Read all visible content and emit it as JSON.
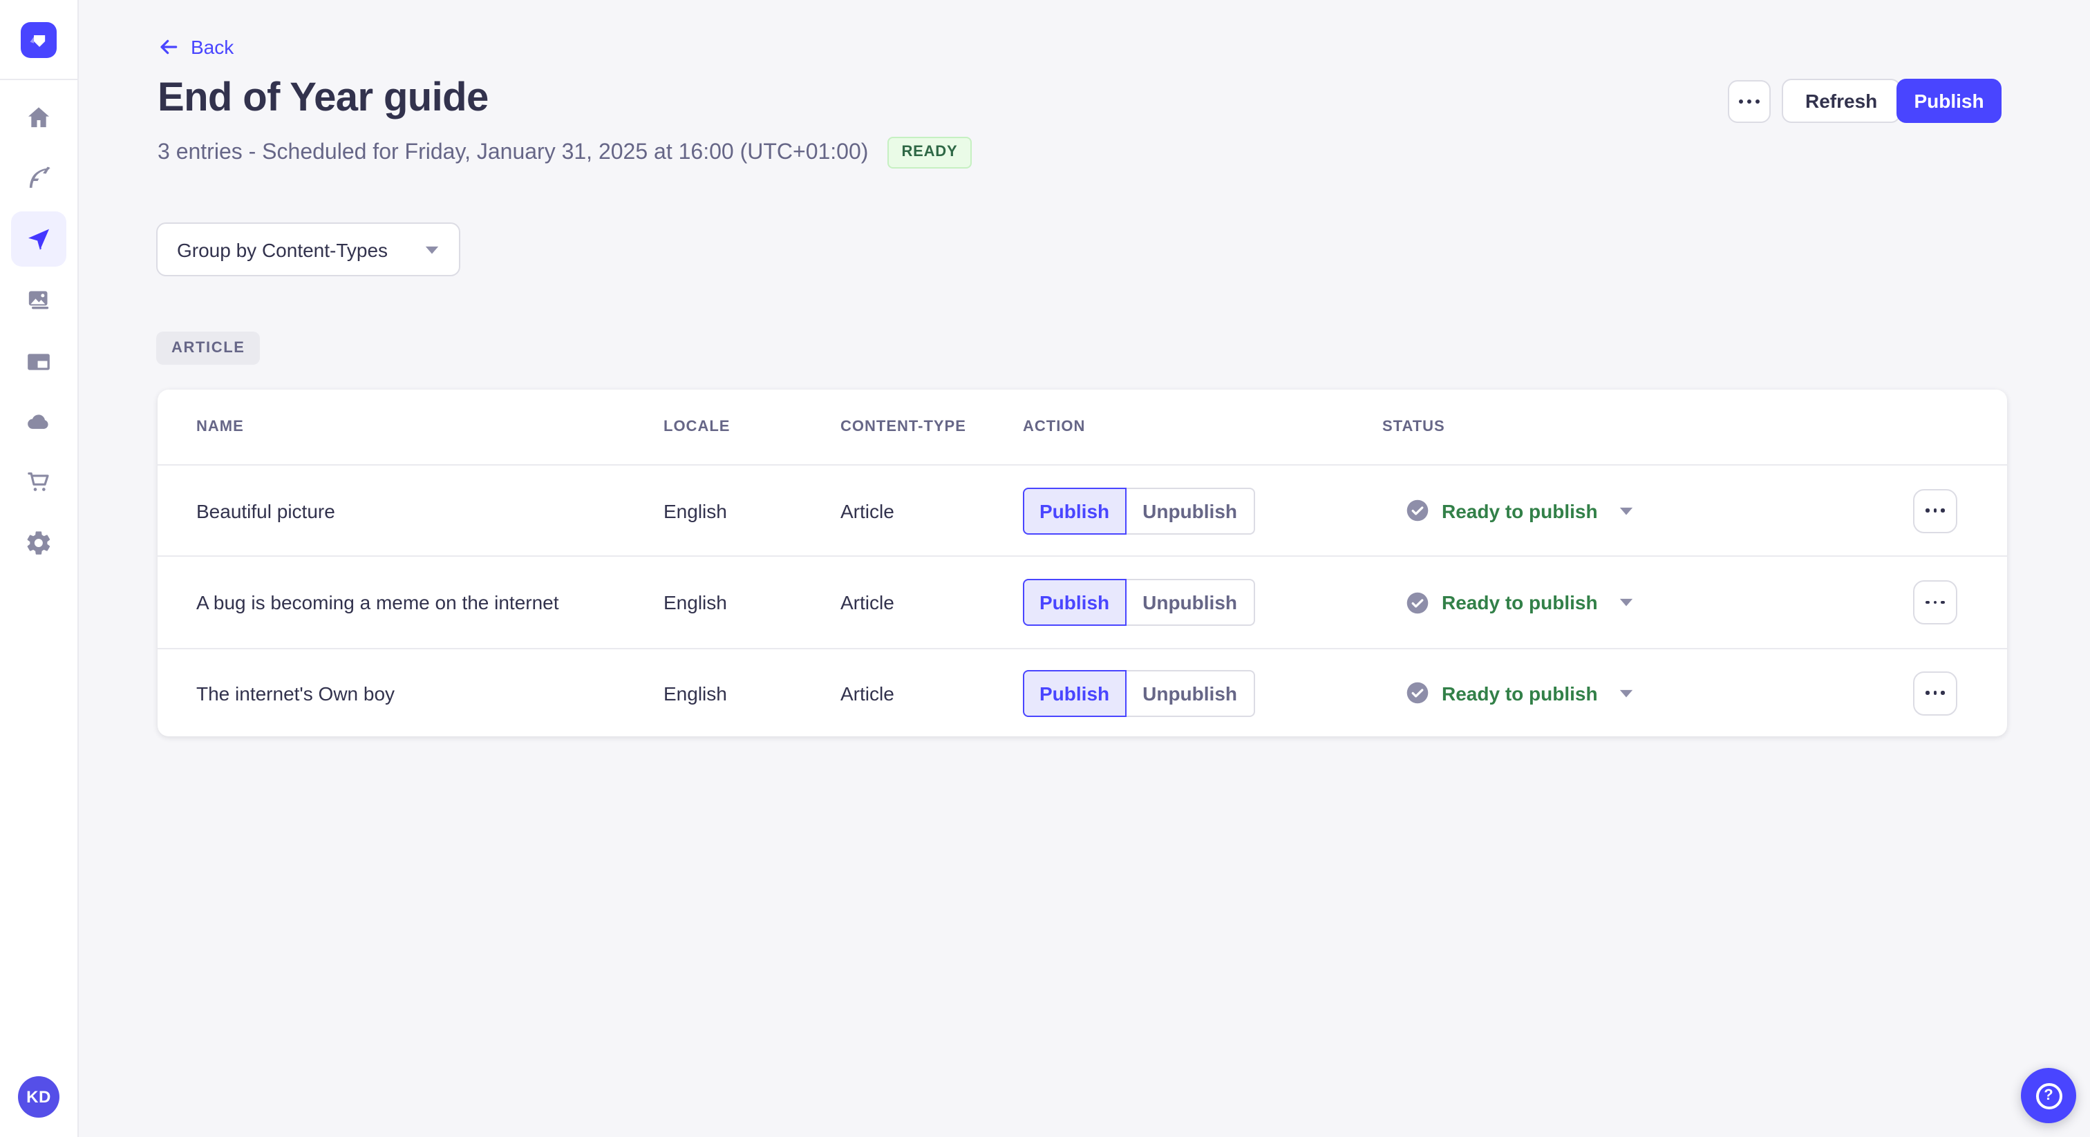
{
  "header": {
    "back_label": "Back",
    "title": "End of Year guide",
    "subtitle": "3 entries - Scheduled for Friday, January 31, 2025 at 16:00 (UTC+01:00)",
    "status_badge": "READY",
    "refresh_label": "Refresh",
    "publish_label": "Publish"
  },
  "filters": {
    "group_by_value": "Group by Content-Types"
  },
  "content_group": {
    "label": "ARTICLE"
  },
  "table": {
    "columns": [
      "NAME",
      "LOCALE",
      "CONTENT-TYPE",
      "ACTION",
      "STATUS"
    ],
    "action_buttons": {
      "publish": "Publish",
      "unpublish": "Unpublish"
    },
    "rows": [
      {
        "name": "Beautiful picture",
        "locale": "English",
        "content_type": "Article",
        "status": "Ready to publish"
      },
      {
        "name": "A bug is becoming a meme on the internet",
        "locale": "English",
        "content_type": "Article",
        "status": "Ready to publish"
      },
      {
        "name": "The internet's Own boy",
        "locale": "English",
        "content_type": "Article",
        "status": "Ready to publish"
      }
    ]
  },
  "sidebar": {
    "avatar_initials": "KD",
    "items": [
      {
        "label": "home"
      },
      {
        "label": "content-manager"
      },
      {
        "label": "releases",
        "active": true
      },
      {
        "label": "media-library"
      },
      {
        "label": "content-type-builder"
      },
      {
        "label": "deploy"
      },
      {
        "label": "marketplace"
      },
      {
        "label": "settings"
      }
    ]
  },
  "fab": {
    "help_symbol": "?"
  },
  "colors": {
    "accent": "#4945ff",
    "accent_bg": "#f0f0ff",
    "page_bg": "#f6f6f9",
    "success_text": "#328048",
    "ready_bg": "#eafbe7",
    "ready_border": "#c6f0c2",
    "ready_text": "#2f6846",
    "text_primary": "#32324d",
    "text_secondary": "#666687",
    "icon_gray": "#8e8ea9",
    "border": "#dcdce4",
    "divider": "#eaeaef"
  }
}
